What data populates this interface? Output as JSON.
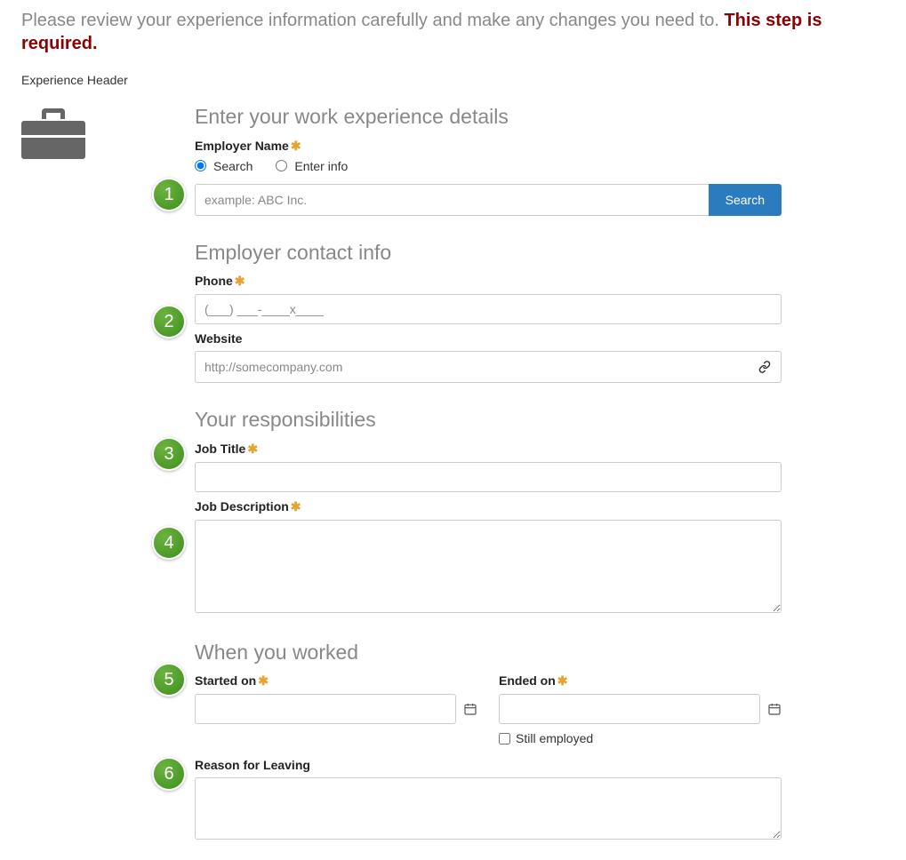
{
  "intro": {
    "text": "Please review your experience information carefully and make any changes you need to. ",
    "required_note": "This step is required."
  },
  "exp_header": "Experience Header",
  "badges": [
    "1",
    "2",
    "3",
    "4",
    "5",
    "6"
  ],
  "sections": {
    "details": {
      "title": "Enter your work experience details",
      "employer_name_label": "Employer Name",
      "radio_search": "Search",
      "radio_enter": "Enter info",
      "employer_placeholder": "example: ABC Inc.",
      "search_button": "Search"
    },
    "contact": {
      "title": "Employer contact info",
      "phone_label": "Phone",
      "phone_placeholder": "(___) ___-____x____",
      "website_label": "Website",
      "website_placeholder": "http://somecompany.com"
    },
    "responsibilities": {
      "title": "Your responsibilities",
      "job_title_label": "Job Title",
      "job_desc_label": "Job Description"
    },
    "when": {
      "title": "When you worked",
      "started_label": "Started on",
      "ended_label": "Ended on",
      "still_employed": "Still employed",
      "reason_label": "Reason for Leaving"
    }
  }
}
